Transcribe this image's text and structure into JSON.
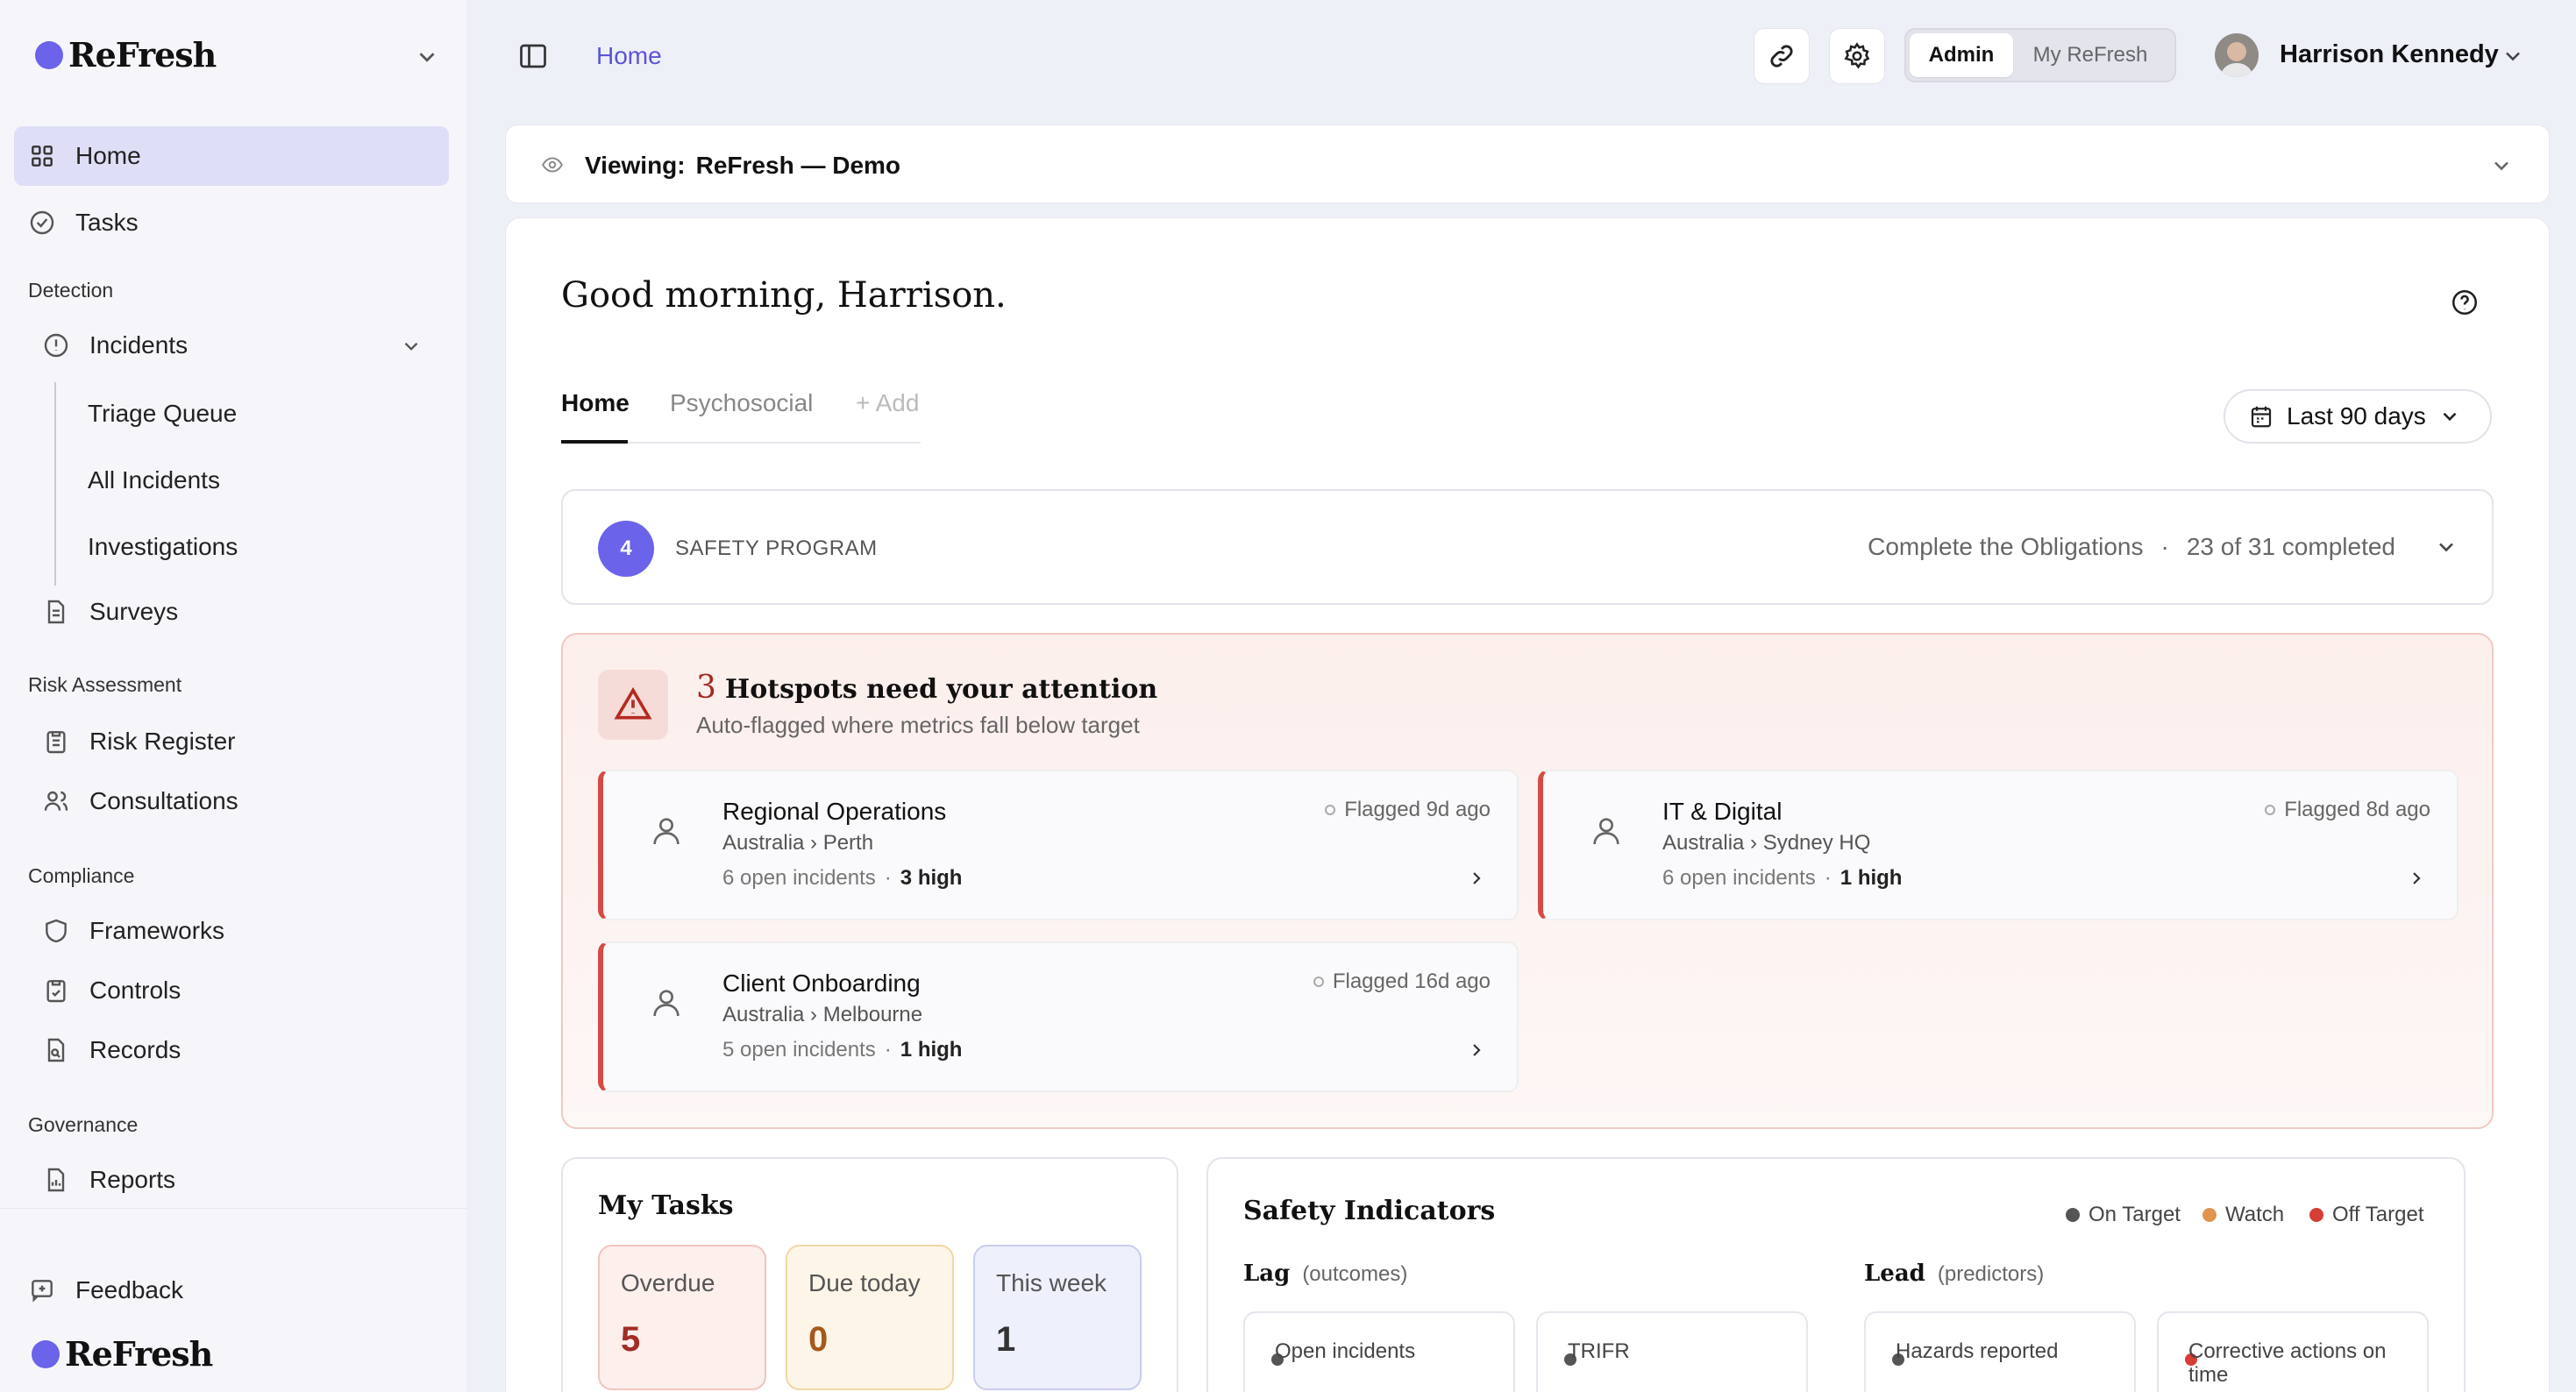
{
  "brand": {
    "name": "ReFresh"
  },
  "sidebar": {
    "home": "Home",
    "tasks": "Tasks",
    "sections": {
      "detection": "Detection",
      "risk": "Risk Assessment",
      "compliance": "Compliance",
      "governance": "Governance"
    },
    "incidents": "Incidents",
    "incident_subitems": [
      "Triage Queue",
      "All Incidents",
      "Investigations"
    ],
    "surveys": "Surveys",
    "risk_register": "Risk Register",
    "consultations": "Consultations",
    "frameworks": "Frameworks",
    "controls": "Controls",
    "records": "Records",
    "reports": "Reports",
    "feedback": "Feedback"
  },
  "topbar": {
    "breadcrumb": "Home",
    "mode_admin": "Admin",
    "mode_my": "My ReFresh",
    "user_name": "Harrison Kennedy"
  },
  "viewing": {
    "label": "Viewing:",
    "value": "ReFresh — Demo"
  },
  "greeting": "Good morning, Harrison.",
  "tabs": {
    "home": "Home",
    "psychosocial": "Psychosocial",
    "add": "+ Add"
  },
  "date_range": "Last 90 days",
  "program": {
    "step": "4",
    "label": "SAFETY PROGRAM",
    "task": "Complete the Obligations",
    "sep": "·",
    "progress": "23 of 31 completed"
  },
  "hotspots": {
    "count": "3",
    "title": "Hotspots need your attention",
    "subtitle": "Auto-flagged where metrics fall below target",
    "items": [
      {
        "name": "Regional Operations",
        "location": "Australia › Perth",
        "open": "6 open incidents",
        "high": "3 high",
        "flagged": "Flagged 9d ago"
      },
      {
        "name": "IT & Digital",
        "location": "Australia › Sydney HQ",
        "open": "6 open incidents",
        "high": "1 high",
        "flagged": "Flagged 8d ago"
      },
      {
        "name": "Client Onboarding",
        "location": "Australia › Melbourne",
        "open": "5 open incidents",
        "high": "1 high",
        "flagged": "Flagged 16d ago"
      }
    ]
  },
  "my_tasks": {
    "title": "My Tasks",
    "overdue_label": "Overdue",
    "overdue": "5",
    "today_label": "Due today",
    "today": "0",
    "week_label": "This week",
    "week": "1"
  },
  "indicators": {
    "title": "Safety Indicators",
    "legend": {
      "on": "On Target",
      "watch": "Watch",
      "off": "Off Target"
    },
    "lag": "Lag",
    "lag_note": "(outcomes)",
    "lead": "Lead",
    "lead_note": "(predictors)",
    "lag_items": [
      "Open incidents",
      "TRIFR"
    ],
    "lead_items": [
      "Hazards reported",
      "Corrective actions on time"
    ],
    "colors": {
      "on": "#555555",
      "watch": "#e0954f",
      "off": "#d63d35"
    }
  }
}
